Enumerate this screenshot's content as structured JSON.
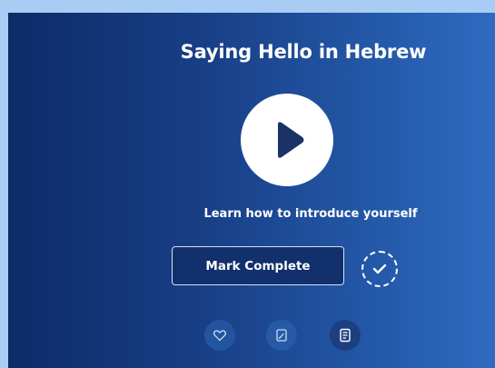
{
  "lesson": {
    "title": "Saying Hello in Hebrew",
    "subtitle": "Learn how to introduce yourself",
    "mark_complete_label": "Mark Complete"
  },
  "icons": {
    "play": "play-icon",
    "check": "check-icon",
    "favorite": "heart-icon",
    "note": "edit-note-icon",
    "transcript": "document-icon"
  },
  "colors": {
    "page_background": "#a9ccf4",
    "card_gradient_start": "#0d2b68",
    "card_gradient_end": "#2e6bc0",
    "play_button": "#ffffff",
    "play_triangle": "#1a3266"
  }
}
